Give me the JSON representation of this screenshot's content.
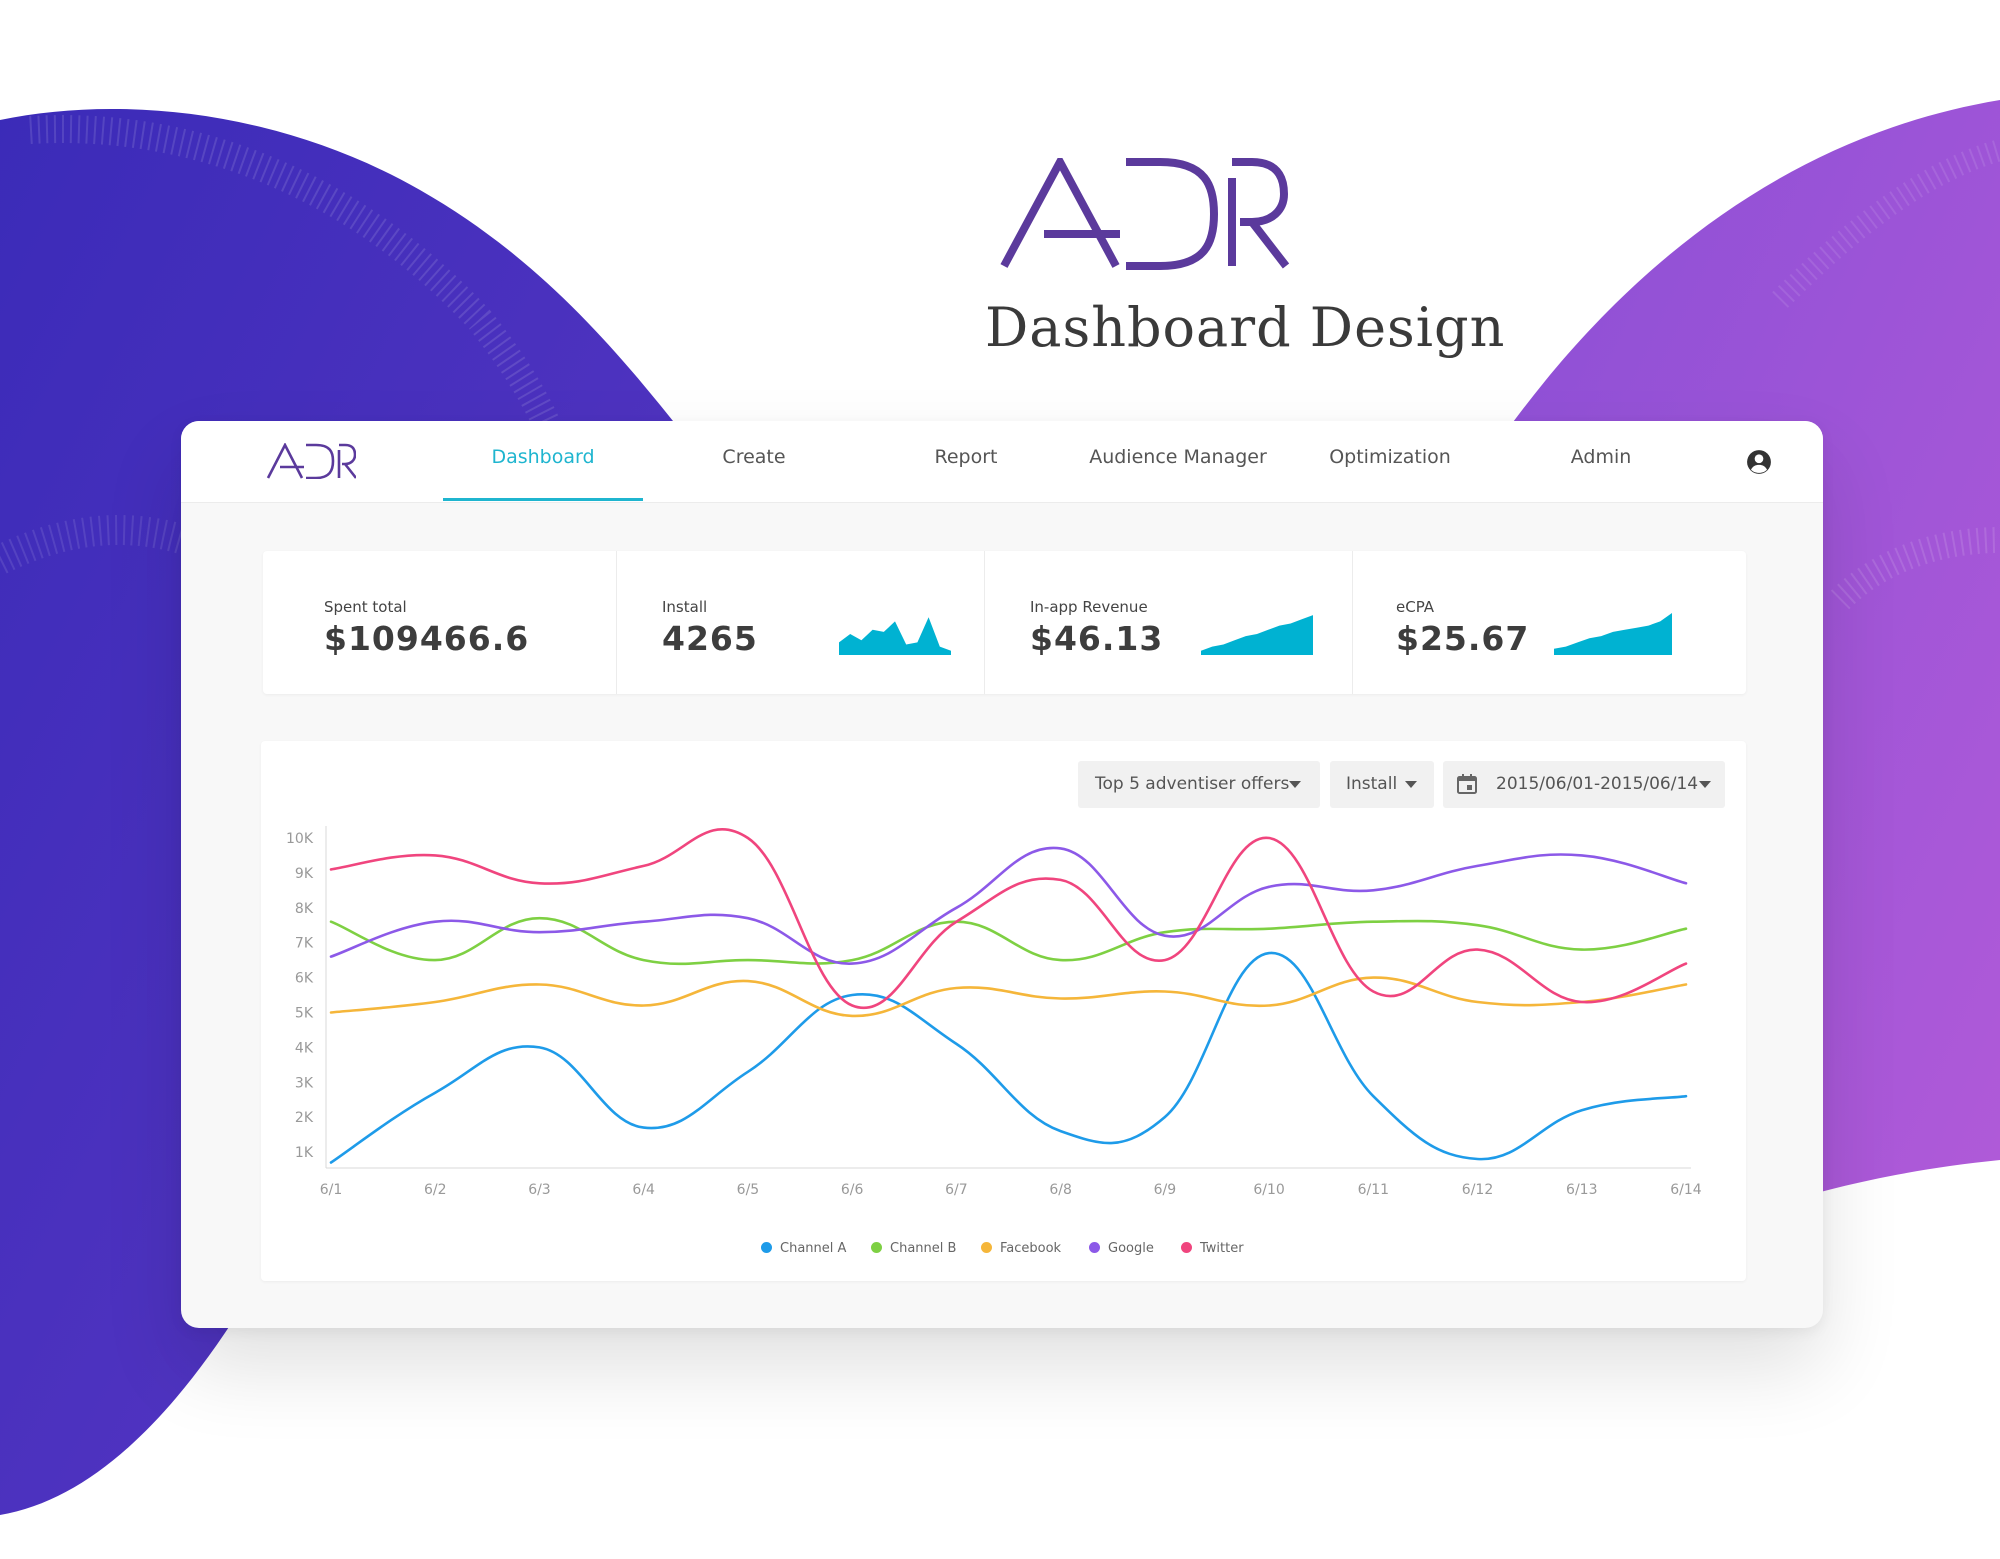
{
  "hero": {
    "logo_text": "ADR",
    "title": "Dashboard Design"
  },
  "brand": {
    "logo_text": "ADR",
    "purple": "#5b3a9c",
    "accent": "#1fb5cf",
    "spark_color": "#00b2d2"
  },
  "nav": {
    "items": [
      {
        "label": "Dashboard",
        "active": true
      },
      {
        "label": "Create",
        "active": false
      },
      {
        "label": "Report",
        "active": false
      },
      {
        "label": "Audience Manager",
        "active": false
      },
      {
        "label": "Optimization",
        "active": false
      },
      {
        "label": "Admin",
        "active": false
      }
    ],
    "user_icon": "account-circle-icon"
  },
  "kpis": [
    {
      "label": "Spent total",
      "value": "$109466.6",
      "sparkline": null
    },
    {
      "label": "Install",
      "value": "4265",
      "sparkline": [
        0.3,
        0.5,
        0.35,
        0.6,
        0.55,
        0.8,
        0.25,
        0.3,
        0.9,
        0.2,
        0.1
      ]
    },
    {
      "label": "In-app Revenue",
      "value": "$46.13",
      "sparkline": [
        0.1,
        0.2,
        0.25,
        0.35,
        0.45,
        0.5,
        0.6,
        0.7,
        0.75,
        0.85,
        0.95
      ]
    },
    {
      "label": "eCPA",
      "value": "$25.67",
      "sparkline": [
        0.15,
        0.2,
        0.3,
        0.4,
        0.45,
        0.55,
        0.6,
        0.65,
        0.7,
        0.8,
        1.0
      ]
    }
  ],
  "filters": {
    "offers": "Top 5 adventiser offers",
    "metric": "Install",
    "date_range": "2015/06/01-2015/06/14",
    "calendar_icon": "calendar-icon",
    "caret_icon": "chevron-down-icon"
  },
  "chart_data": {
    "type": "line",
    "categories": [
      "6/1",
      "6/2",
      "6/3",
      "6/4",
      "6/5",
      "6/6",
      "6/7",
      "6/8",
      "6/9",
      "6/10",
      "6/11",
      "6/12",
      "6/13",
      "6/14"
    ],
    "y_ticks": [
      "1K",
      "2K",
      "3K",
      "4K",
      "5K",
      "6K",
      "7K",
      "8K",
      "9K",
      "10K"
    ],
    "ylim": [
      0.6,
      10.2
    ],
    "smooth": true,
    "grid": false,
    "legend_position": "bottom-center",
    "series": [
      {
        "name": "Channel A",
        "color": "#1e9be9",
        "values": [
          0.7,
          2.7,
          4.0,
          1.7,
          3.3,
          5.5,
          4.1,
          1.6,
          2.0,
          6.7,
          2.6,
          0.8,
          2.2,
          2.6
        ]
      },
      {
        "name": "Channel B",
        "color": "#7ed043",
        "values": [
          7.6,
          6.5,
          7.7,
          6.5,
          6.5,
          6.5,
          7.6,
          6.5,
          7.3,
          7.4,
          7.6,
          7.5,
          6.8,
          7.4
        ]
      },
      {
        "name": "Facebook",
        "color": "#f5b63a",
        "values": [
          5.0,
          5.3,
          5.8,
          5.2,
          5.9,
          4.9,
          5.7,
          5.4,
          5.6,
          5.2,
          6.0,
          5.3,
          5.3,
          5.8
        ]
      },
      {
        "name": "Google",
        "color": "#8c59e8",
        "values": [
          6.6,
          7.6,
          7.3,
          7.6,
          7.7,
          6.4,
          8.0,
          9.7,
          7.2,
          8.6,
          8.5,
          9.2,
          9.5,
          8.7
        ]
      },
      {
        "name": "Twitter",
        "color": "#f0457e",
        "values": [
          9.1,
          9.5,
          8.7,
          9.2,
          10.0,
          5.2,
          7.6,
          8.8,
          6.5,
          10.0,
          5.6,
          6.8,
          5.3,
          6.4
        ]
      }
    ]
  }
}
